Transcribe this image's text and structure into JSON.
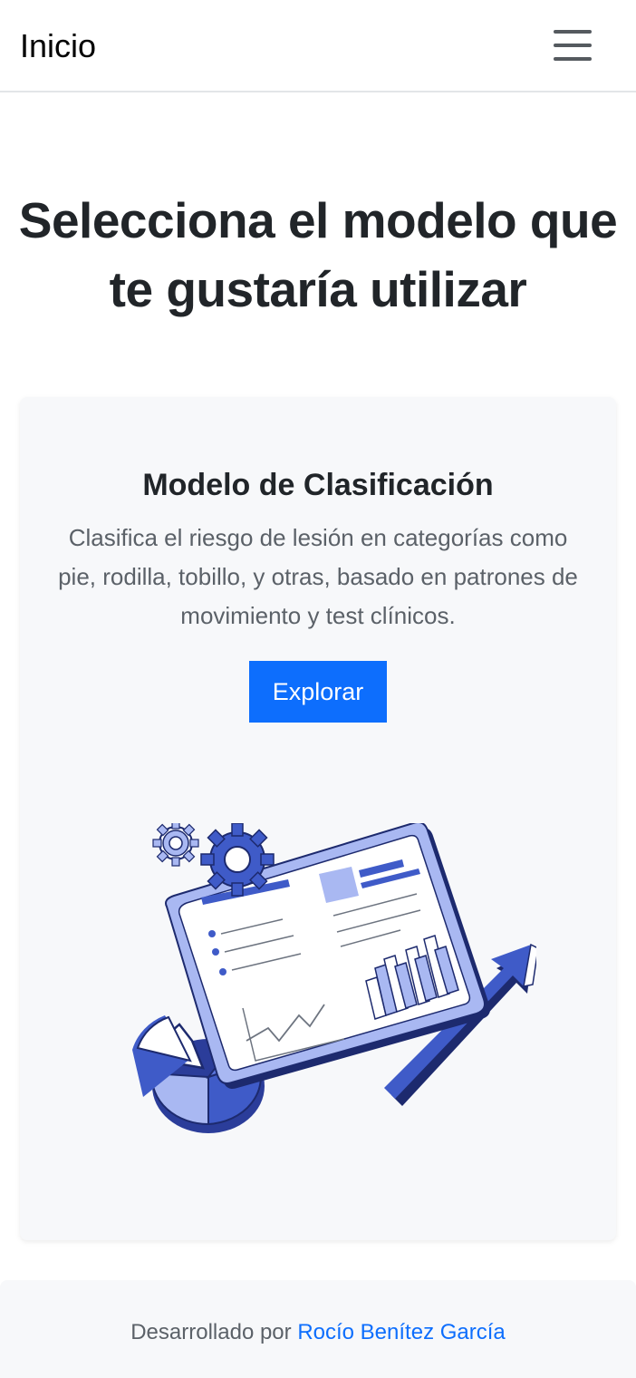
{
  "navbar": {
    "brand": "Inicio",
    "menu_icon": "hamburger-menu-icon"
  },
  "main": {
    "title": "Selecciona el modelo que te gustaría utilizar"
  },
  "card": {
    "title": "Modelo de Clasificación",
    "description": "Clasifica el riesgo de lesión en categorías como pie, rodilla, tobillo, y otras, basado en patrones de movimiento y test clínicos.",
    "button_label": "Explorar",
    "illustration": "data-analytics-illustration"
  },
  "footer": {
    "prefix": "Desarrollado por",
    "author": "Rocío Benítez García"
  },
  "colors": {
    "primary": "#0d6efd",
    "illustration_blue": "#3f5bc8",
    "illustration_light": "#a9b8f2",
    "card_bg": "#f7f8fa"
  }
}
